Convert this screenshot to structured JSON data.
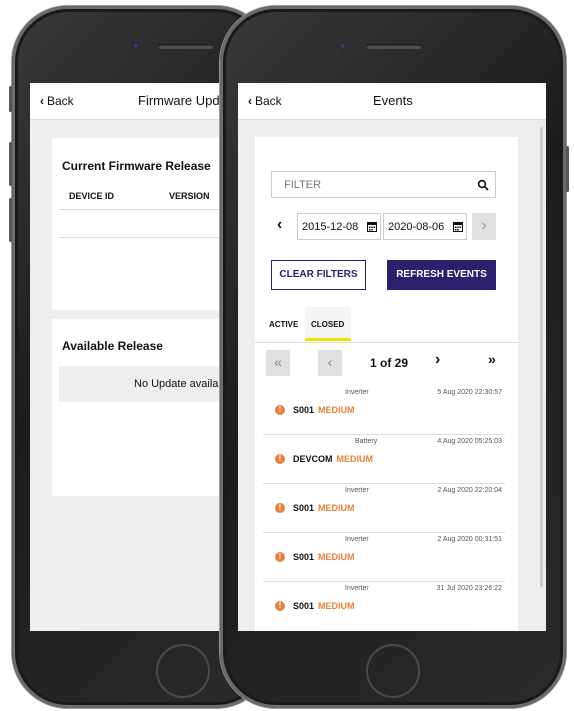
{
  "left": {
    "back": "Back",
    "title": "Firmware Upda",
    "current_heading": "Current Firmware Release",
    "columns": [
      "DEVICE ID",
      "VERSION"
    ],
    "available_heading": "Available Release",
    "no_update": "No Update availa"
  },
  "right": {
    "back": "Back",
    "title": "Events",
    "filter_placeholder": "FILTER",
    "date_from": "2015-12-08",
    "date_to": "2020-08-06",
    "clear_label": "CLEAR FILTERS",
    "refresh_label": "REFRESH EVENTS",
    "tabs": [
      "ACTIVE",
      "CLOSED"
    ],
    "page_info": "1 of 29",
    "events": [
      {
        "type": "Inverter",
        "time": "5 Aug 2020 22:30:57",
        "id": "S001",
        "severity": "MEDIUM"
      },
      {
        "type": "Battery",
        "time": "4 Aug 2020 05:25:03",
        "id": "DEVCOM",
        "severity": "MEDIUM"
      },
      {
        "type": "Inverter",
        "time": "2 Aug 2020 22:20:04",
        "id": "S001",
        "severity": "MEDIUM"
      },
      {
        "type": "Inverter",
        "time": "2 Aug 2020 00:31:51",
        "id": "S001",
        "severity": "MEDIUM"
      },
      {
        "type": "Inverter",
        "time": "31 Jul 2020 23:26:22",
        "id": "S001",
        "severity": "MEDIUM"
      }
    ]
  },
  "colors": {
    "accent": "#2c1f6b",
    "severity_medium": "#e8813b",
    "tab_underline": "#f0e000"
  }
}
